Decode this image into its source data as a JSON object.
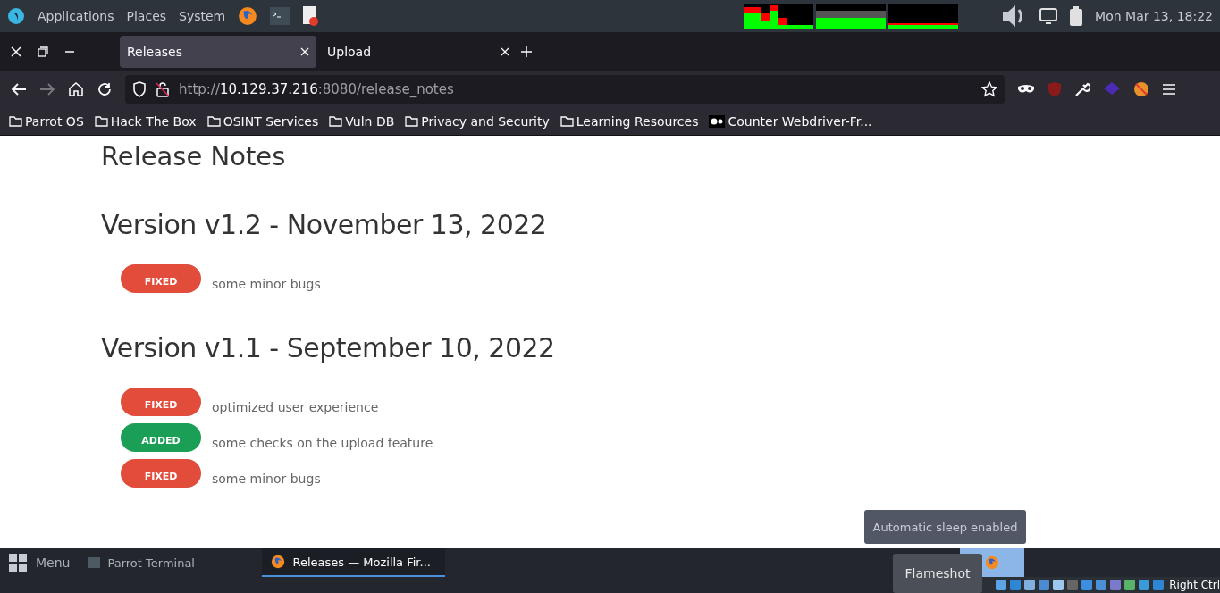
{
  "top_panel": {
    "menus": [
      "Applications",
      "Places",
      "System"
    ],
    "clock": "Mon Mar 13, 18:22"
  },
  "browser": {
    "tabs": [
      {
        "label": "Releases",
        "selected": true
      },
      {
        "label": "Upload",
        "selected": false
      }
    ],
    "url": {
      "scheme": "http://",
      "host": "10.129.37.216",
      "rest": ":8080/release_notes"
    },
    "bookmarks": [
      {
        "label": "Parrot OS",
        "kind": "folder"
      },
      {
        "label": "Hack The Box",
        "kind": "folder"
      },
      {
        "label": "OSINT Services",
        "kind": "folder"
      },
      {
        "label": "Vuln DB",
        "kind": "folder"
      },
      {
        "label": "Privacy and Security",
        "kind": "folder"
      },
      {
        "label": "Learning Resources",
        "kind": "folder"
      },
      {
        "label": "Counter Webdriver-Fr...",
        "kind": "site"
      }
    ]
  },
  "page": {
    "title": "Release Notes",
    "versions": [
      {
        "heading": "Version v1.2 - November 13, 2022",
        "entries": [
          {
            "tag": "FIXED",
            "kind": "fixed",
            "text": "some minor bugs"
          }
        ]
      },
      {
        "heading": "Version v1.1 - September 10, 2022",
        "entries": [
          {
            "tag": "FIXED",
            "kind": "fixed",
            "text": "optimized user experience"
          },
          {
            "tag": "ADDED",
            "kind": "added",
            "text": "some checks on the upload feature"
          },
          {
            "tag": "FIXED",
            "kind": "fixed",
            "text": "some minor bugs"
          }
        ]
      }
    ]
  },
  "notification": "Automatic sleep enabled",
  "tooltip": "Flameshot",
  "taskbar": {
    "menu": "Menu",
    "windows": [
      {
        "label": "Parrot Terminal",
        "kind": "terminal",
        "selected": false
      },
      {
        "label": "Releases — Mozilla Fir...",
        "kind": "firefox",
        "selected": true
      }
    ],
    "keyboard_hint": "Right Ctrl"
  }
}
